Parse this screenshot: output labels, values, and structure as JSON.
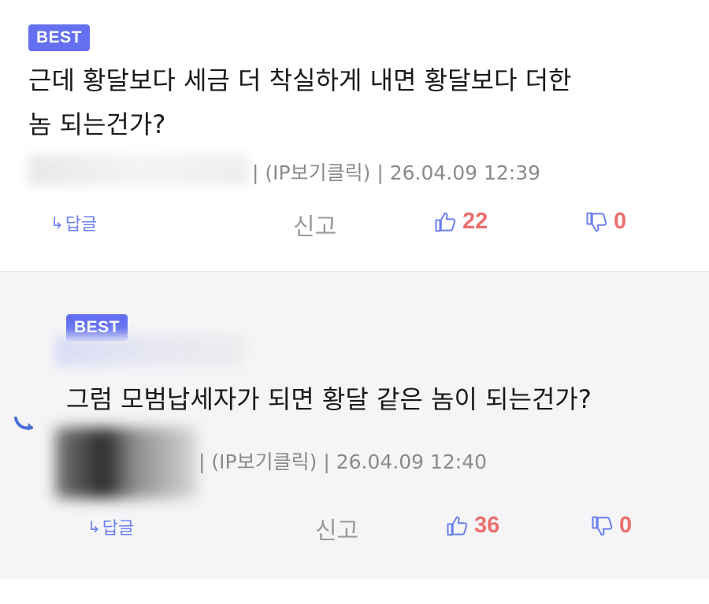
{
  "colors": {
    "badge": "#6470f0",
    "accent": "#6b7ff0",
    "count": "#ec6f6f",
    "meta": "#8a8a8a"
  },
  "comments": [
    {
      "badge": "BEST",
      "text_line1": "근데 황달보다 세금 더 착실하게 내면 황달보다 더한",
      "text_line2": "놈 되는건가?",
      "ip_label": "(IP보기클릭)",
      "separator": "|",
      "datetime": "26.04.09 12:39",
      "reply_label": "답글",
      "report_label": "신고",
      "likes": "22",
      "dislikes": "0"
    },
    {
      "badge": "BEST",
      "text": "그럼 모범납세자가 되면 황달 같은 놈이 되는건가?",
      "ip_label": "(IP보기클릭)",
      "separator": "|",
      "datetime": "26.04.09 12:40",
      "reply_label": "답글",
      "report_label": "신고",
      "likes": "36",
      "dislikes": "0"
    }
  ],
  "icons": {
    "reply": "reply-arrow-icon",
    "like": "thumbs-up-icon",
    "dislike": "thumbs-down-icon",
    "nested": "nested-reply-icon"
  }
}
